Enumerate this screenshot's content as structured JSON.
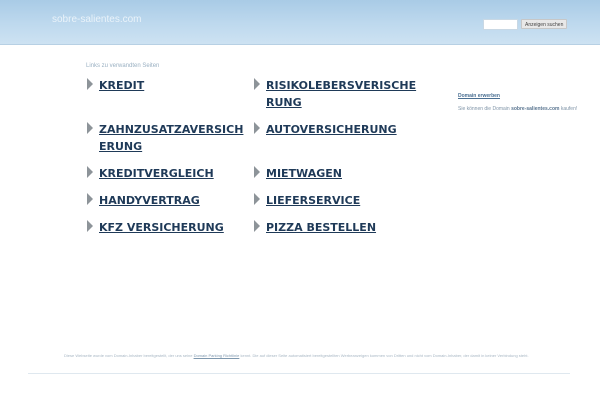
{
  "header": {
    "site_name": "sobre-salientes.com",
    "search_button": "Anzeigen suchen"
  },
  "section_title": "Links zu verwandten Seiten",
  "links": [
    {
      "label": "KREDIT"
    },
    {
      "label": "RISIKOLEBERSVERISCHERUNG"
    },
    {
      "label": "ZAHNZUSATZAVERSICHERUNG"
    },
    {
      "label": "AUTOVERSICHERUNG"
    },
    {
      "label": "KREDITVERGLEICH"
    },
    {
      "label": "MIETWAGEN"
    },
    {
      "label": "HANDYVERTRAG"
    },
    {
      "label": "LIEFERSERVICE"
    },
    {
      "label": "KFZ VERSICHERUNG"
    },
    {
      "label": "PIZZA BESTELLEN"
    }
  ],
  "sidebar": {
    "domain_link": "Domain erwerben",
    "note_prefix": "Sie können die Domain",
    "note_domain": "sobre-salientes.com",
    "note_suffix": "kaufen!"
  },
  "footer": {
    "text_before": "Diese Webseite wurde vom Domain-Inhaber bereitgestellt, der uns seine",
    "policy_link": "Domain Parking Richtlinie",
    "text_after": "kennt. Die auf dieser Seite automatisiert bereitgestellten Werbeanzeigen kommen von Dritten und nicht vom Domain-Inhaber, der damit in keiner Verbindung steht."
  },
  "colors": {
    "header_top": "#a9cbe6",
    "link": "#1f3a58",
    "arrow": "#8d9499"
  },
  "icons": {
    "link_arrow": "triangle-right"
  }
}
